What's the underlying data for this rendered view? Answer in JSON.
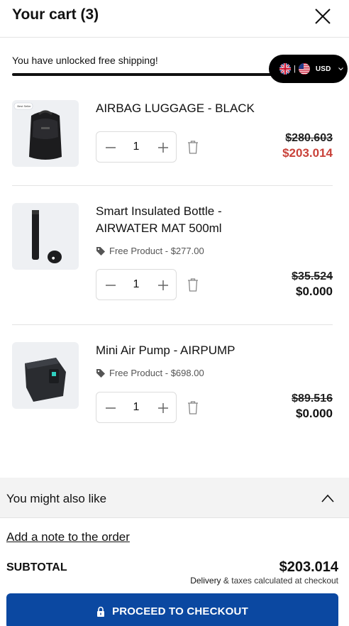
{
  "header": {
    "title": "Your cart (3)"
  },
  "shipping": {
    "message": "You have unlocked free shipping!",
    "progress": 1.0
  },
  "currency": {
    "code": "USD"
  },
  "items": [
    {
      "name": "AIRBAG LUGGAGE - BLACK",
      "badge": "Best Seller",
      "quantity": "1",
      "original_price": "$280.603",
      "price": "$203.014",
      "price_color": "#c9423a",
      "free_label": ""
    },
    {
      "name": "Smart Insulated Bottle - AIRWATER MAT 500ml",
      "quantity": "1",
      "original_price": "$35.524",
      "price": "$0.000",
      "price_color": "#111111",
      "free_label": "Free Product - $277.00"
    },
    {
      "name": "Mini Air Pump - AIRPUMP",
      "quantity": "1",
      "original_price": "$89.516",
      "price": "$0.000",
      "price_color": "#111111",
      "free_label": "Free Product - $698.00"
    }
  ],
  "also_like": {
    "label": "You might also like"
  },
  "note": {
    "label": "Add a note to the order"
  },
  "summary": {
    "subtotal_label": "SUBTOTAL",
    "subtotal_value": "$203.014",
    "tax_strong": "Delivery",
    "tax_rest": "& taxes calculated at checkout"
  },
  "checkout": {
    "label": "PROCEED TO CHECKOUT",
    "color": "#0b48a1"
  }
}
